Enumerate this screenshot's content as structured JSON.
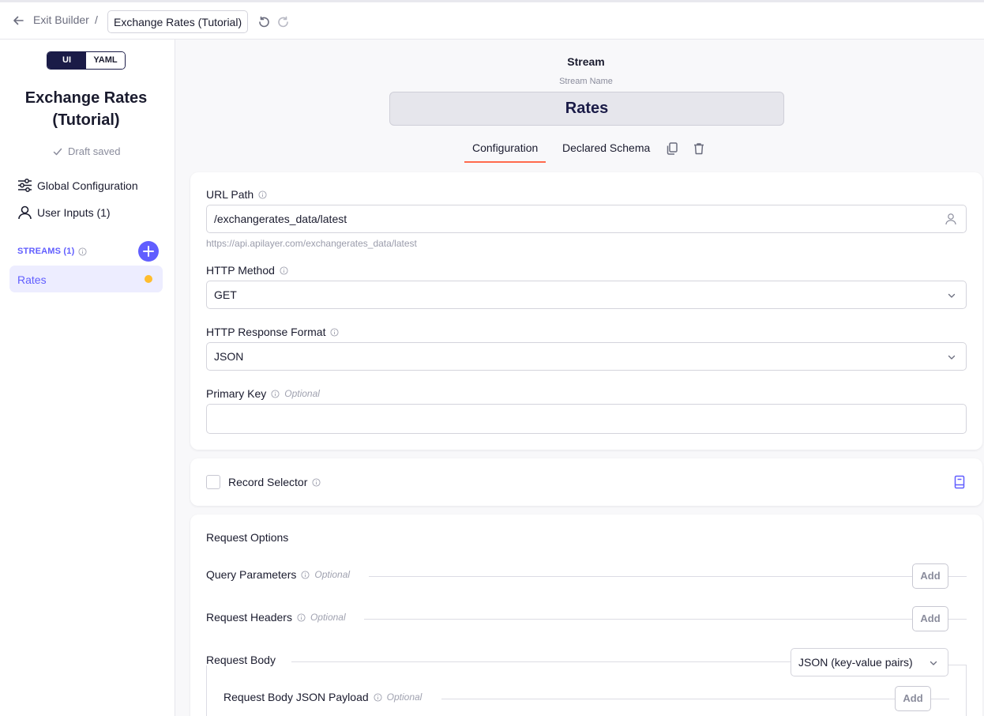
{
  "header": {
    "exit_label": "Exit Builder",
    "separator": "/",
    "connector_name": "Exchange Rates (Tutorial)"
  },
  "sidebar": {
    "mode_options": [
      "UI",
      "YAML"
    ],
    "title": "Exchange Rates (Tutorial)",
    "draft_status": "Draft saved",
    "nav": [
      {
        "label": "Global Configuration",
        "icon": "sliders-icon"
      },
      {
        "label": "User Inputs (1)",
        "icon": "user-icon"
      }
    ],
    "streams_heading": "STREAMS (1)",
    "streams": [
      {
        "label": "Rates",
        "status_color": "#ffbd2e"
      }
    ]
  },
  "main": {
    "heading": "Stream",
    "stream_name_label": "Stream Name",
    "stream_name_value": "Rates",
    "tabs": [
      {
        "label": "Configuration",
        "active": true
      },
      {
        "label": "Declared Schema",
        "active": false
      }
    ],
    "url_path": {
      "label": "URL Path",
      "value": "/exchangerates_data/latest",
      "hint": "https://api.apilayer.com/exchangerates_data/latest"
    },
    "http_method": {
      "label": "HTTP Method",
      "value": "GET"
    },
    "response_format": {
      "label": "HTTP Response Format",
      "value": "JSON"
    },
    "primary_key": {
      "label": "Primary Key",
      "optional": "Optional",
      "value": ""
    },
    "record_selector": {
      "label": "Record Selector"
    },
    "request_options": {
      "title": "Request Options",
      "query_params": {
        "label": "Query Parameters",
        "optional": "Optional",
        "add": "Add"
      },
      "request_headers": {
        "label": "Request Headers",
        "optional": "Optional",
        "add": "Add"
      },
      "request_body": {
        "label": "Request Body",
        "value": "JSON (key-value pairs)"
      },
      "json_payload": {
        "label": "Request Body JSON Payload",
        "optional": "Optional",
        "add": "Add"
      }
    }
  },
  "colors": {
    "accent": "#615eff",
    "navy": "#1a1b47",
    "tab_underline": "#ff6a4d",
    "status_dot": "#ffbd2e"
  }
}
